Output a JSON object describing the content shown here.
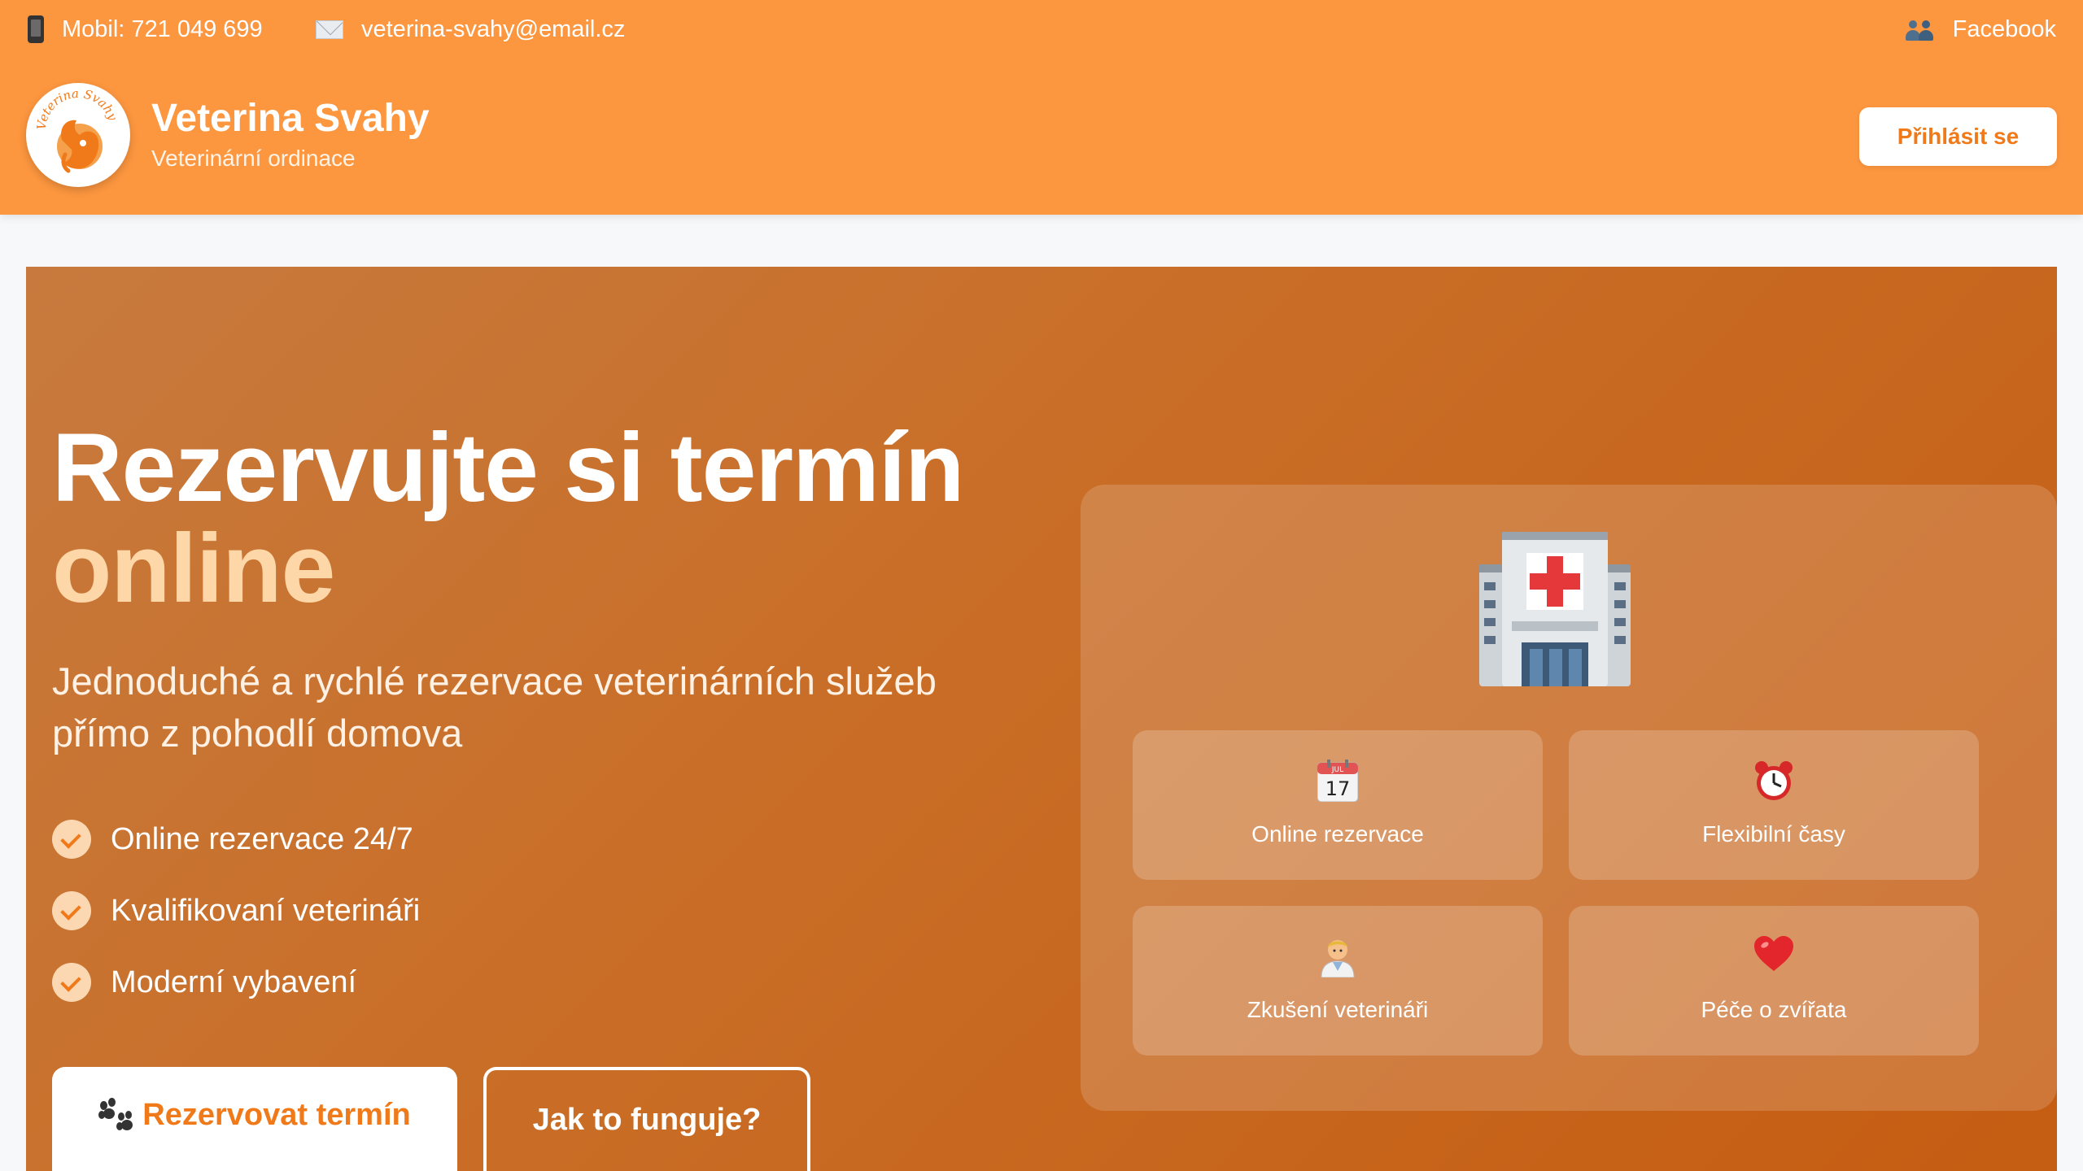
{
  "topbar": {
    "phone": "Mobil: 721 049 699",
    "email": "veterina-svahy@email.cz",
    "facebook": "Facebook"
  },
  "brand": {
    "title": "Veterina Svahy",
    "subtitle": "Veterinární ordinace",
    "logo_text": "Veterina Svahy"
  },
  "header": {
    "login_label": "Přihlásit se"
  },
  "hero": {
    "title": "Rezervujte si termín",
    "title_accent": "online",
    "lead": "Jednoduché a rychlé rezervace veterinárních služeb přímo z pohodlí domova",
    "features": [
      "Online rezervace 24/7",
      "Kvalifikovaní veterináři",
      "Moderní vybavení"
    ],
    "primary_button": "Rezervovat termín",
    "secondary_button": "Jak to funguje?"
  },
  "panel": {
    "cards": [
      {
        "label": "Online rezervace",
        "icon": "calendar-icon",
        "calendar_month": "JUL",
        "calendar_day": "17"
      },
      {
        "label": "Flexibilní časy",
        "icon": "alarm-clock-icon"
      },
      {
        "label": "Zkušení veterináři",
        "icon": "doctor-icon"
      },
      {
        "label": "Péče o zvířata",
        "icon": "heart-icon"
      }
    ]
  },
  "colors": {
    "header": "#fc963f",
    "accent": "#f07a1a",
    "hero_gradient_start": "#c87a3e",
    "hero_gradient_end": "#c55d12",
    "title_accent": "#fed7a8"
  }
}
